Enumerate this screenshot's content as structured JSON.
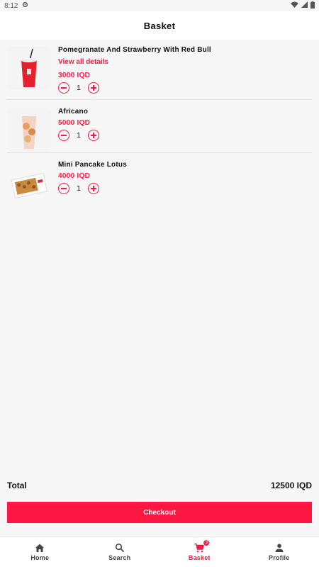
{
  "status_bar": {
    "time": "8:12"
  },
  "header": {
    "title": "Basket"
  },
  "items": [
    {
      "name": "Pomegranate And Strawberry With Red Bull",
      "details_link": "View all details",
      "price": "3000 IQD",
      "quantity": "1"
    },
    {
      "name": "Africano",
      "details_link": "",
      "price": "5000 IQD",
      "quantity": "1"
    },
    {
      "name": "Mini Pancake Lotus",
      "details_link": "",
      "price": "4000 IQD",
      "quantity": "1"
    }
  ],
  "summary": {
    "total_label": "Total",
    "total_value": "12500 IQD"
  },
  "checkout_label": "Checkout",
  "nav": {
    "home": "Home",
    "search": "Search",
    "basket": "Basket",
    "basket_badge": "3",
    "profile": "Profile"
  },
  "colors": {
    "accent": "#ff1744",
    "background": "#f7f7f7"
  },
  "icons": [
    "settings-icon",
    "wifi-icon",
    "signal-icon",
    "battery-icon",
    "minus-icon",
    "plus-icon",
    "home-icon",
    "search-icon",
    "cart-icon",
    "person-icon"
  ]
}
